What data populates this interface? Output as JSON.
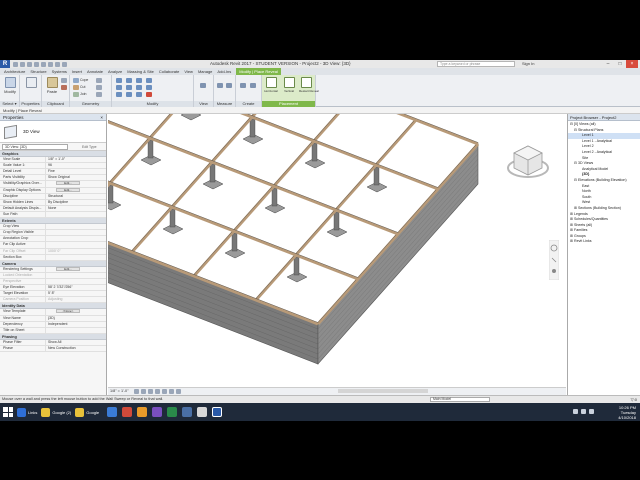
{
  "window": {
    "app_logo": "R",
    "title": "Autodesk Revit 2017 - STUDENT VERSION  -  Project2 - 3D View: {3D}",
    "search_placeholder": "Type a keyword or phrase",
    "sign_in": "Sign In"
  },
  "ribbon_tabs": [
    "Architecture",
    "Structure",
    "Systems",
    "Insert",
    "Annotate",
    "Analyze",
    "Massing & Site",
    "Collaborate",
    "View",
    "Manage",
    "Add-Ins",
    "Modify | Place Reveal"
  ],
  "ribbon": {
    "modify_label": "Modify",
    "groups": {
      "select": "Select ▾",
      "properties": "Properties",
      "clipboard": "Clipboard",
      "geometry": "Geometry",
      "modify": "Modify",
      "view": "View",
      "measure": "Measure",
      "create": "Create",
      "placement": "Placement"
    },
    "small_labels": {
      "cope": "Cope",
      "cut": "Cut",
      "join": "Join",
      "paste": "Paste"
    },
    "placement_buttons": [
      "Horizontal",
      "Vertical",
      "Restart Reveal"
    ]
  },
  "options_bar": "Modify | Place Reveal",
  "properties": {
    "title": "Properties",
    "close": "×",
    "type_name": "3D View",
    "selector": "3D View: {3D}",
    "edit_type": "Edit Type",
    "rows": [
      {
        "kind": "section",
        "k": "Graphics"
      },
      {
        "kind": "row",
        "k": "View Scale",
        "v": "1/8\" = 1'-0\""
      },
      {
        "kind": "row",
        "k": "Scale Value  1:",
        "v": "96"
      },
      {
        "kind": "row",
        "k": "Detail Level",
        "v": "Fine"
      },
      {
        "kind": "row",
        "k": "Parts Visibility",
        "v": "Show Original"
      },
      {
        "kind": "row",
        "k": "Visibility/Graphics Over...",
        "v": "",
        "btn": "Edit..."
      },
      {
        "kind": "row",
        "k": "Graphic Display Options",
        "v": "",
        "btn": "Edit..."
      },
      {
        "kind": "row",
        "k": "Discipline",
        "v": "Structural"
      },
      {
        "kind": "row",
        "k": "Show Hidden Lines",
        "v": "By Discipline"
      },
      {
        "kind": "row",
        "k": "Default Analysis Displa...",
        "v": "None"
      },
      {
        "kind": "row",
        "k": "Sun Path",
        "v": ""
      },
      {
        "kind": "section",
        "k": "Extents"
      },
      {
        "kind": "row",
        "k": "Crop View",
        "v": ""
      },
      {
        "kind": "row",
        "k": "Crop Region Visible",
        "v": ""
      },
      {
        "kind": "row",
        "k": "Annotation Crop",
        "v": ""
      },
      {
        "kind": "row",
        "k": "Far Clip Active",
        "v": ""
      },
      {
        "kind": "row",
        "k": "Far Clip Offset",
        "v": "1000' 0\"",
        "dim": true
      },
      {
        "kind": "row",
        "k": "Section Box",
        "v": ""
      },
      {
        "kind": "section",
        "k": "Camera"
      },
      {
        "kind": "row",
        "k": "Rendering Settings",
        "v": "",
        "btn": "Edit..."
      },
      {
        "kind": "row",
        "k": "Locked Orientation",
        "v": "",
        "dim": true
      },
      {
        "kind": "row",
        "k": "Perspective",
        "v": "",
        "dim": true
      },
      {
        "kind": "row",
        "k": "Eye Elevation",
        "v": "58' 2 7/32\"/256\""
      },
      {
        "kind": "row",
        "k": "Target Elevation",
        "v": "5' 8\""
      },
      {
        "kind": "row",
        "k": "Camera Position",
        "v": "Adjusting",
        "dim": true
      },
      {
        "kind": "section",
        "k": "Identity Data"
      },
      {
        "kind": "row",
        "k": "View Template",
        "v": "",
        "btn": "<None>"
      },
      {
        "kind": "row",
        "k": "View Name",
        "v": "{3D}"
      },
      {
        "kind": "row",
        "k": "Dependency",
        "v": "Independent"
      },
      {
        "kind": "row",
        "k": "Title on Sheet",
        "v": ""
      },
      {
        "kind": "section",
        "k": "Phasing"
      },
      {
        "kind": "row",
        "k": "Phase Filter",
        "v": "Show All"
      },
      {
        "kind": "row",
        "k": "Phase",
        "v": "New Construction"
      }
    ],
    "help_link": "Properties help",
    "apply": "Apply"
  },
  "browser": {
    "title": "Project Browser - Project2",
    "tree": [
      {
        "t": "⊟ [0] Views (all)",
        "d": 0
      },
      {
        "t": "⊟ Structural Plans",
        "d": 1
      },
      {
        "t": "Level 1",
        "d": 3,
        "sel": true
      },
      {
        "t": "Level 1 - Analytical",
        "d": 3
      },
      {
        "t": "Level 2",
        "d": 3
      },
      {
        "t": "Level 2 - Analytical",
        "d": 3
      },
      {
        "t": "Site",
        "d": 3
      },
      {
        "t": "⊟ 3D Views",
        "d": 1
      },
      {
        "t": "Analytical Model",
        "d": 3
      },
      {
        "t": "{3D}",
        "d": 3,
        "bold": true
      },
      {
        "t": "⊟ Elevations (Building Elevation)",
        "d": 1
      },
      {
        "t": "East",
        "d": 3
      },
      {
        "t": "North",
        "d": 3
      },
      {
        "t": "South",
        "d": 3
      },
      {
        "t": "West",
        "d": 3
      },
      {
        "t": "⊞ Sections (Building Section)",
        "d": 1
      },
      {
        "t": "⊞ Legends",
        "d": 0
      },
      {
        "t": "⊞ Schedules/Quantities",
        "d": 0
      },
      {
        "t": "⊞ Sheets (all)",
        "d": 0
      },
      {
        "t": "⊞ Families",
        "d": 0
      },
      {
        "t": "⊞ Groups",
        "d": 0
      },
      {
        "t": "⊞ Revit Links",
        "d": 0
      }
    ]
  },
  "view_control": {
    "scale": "1/8\" = 1'-0\""
  },
  "status": {
    "message": "Mouse over a wall and press the left mouse button to add the Wall Sweep or Reveal to that wall.",
    "model": "Main Model",
    "filter": "▽:0"
  },
  "taskbar": {
    "items": [
      {
        "label": "Links",
        "color": "#2f6fd6"
      },
      {
        "label": "Google (2)",
        "color": "#e8c23a"
      },
      {
        "label": "Google",
        "color": "#e8c23a"
      }
    ],
    "clock_time": "10:26 PM",
    "clock_day": "Tuesday",
    "clock_date": "4/10/2018"
  },
  "colors": {
    "context_tab": "#7fb84a",
    "taskbar": "#1f2a3a",
    "beam": "#b89a78",
    "wall": "#7a7a7a"
  }
}
